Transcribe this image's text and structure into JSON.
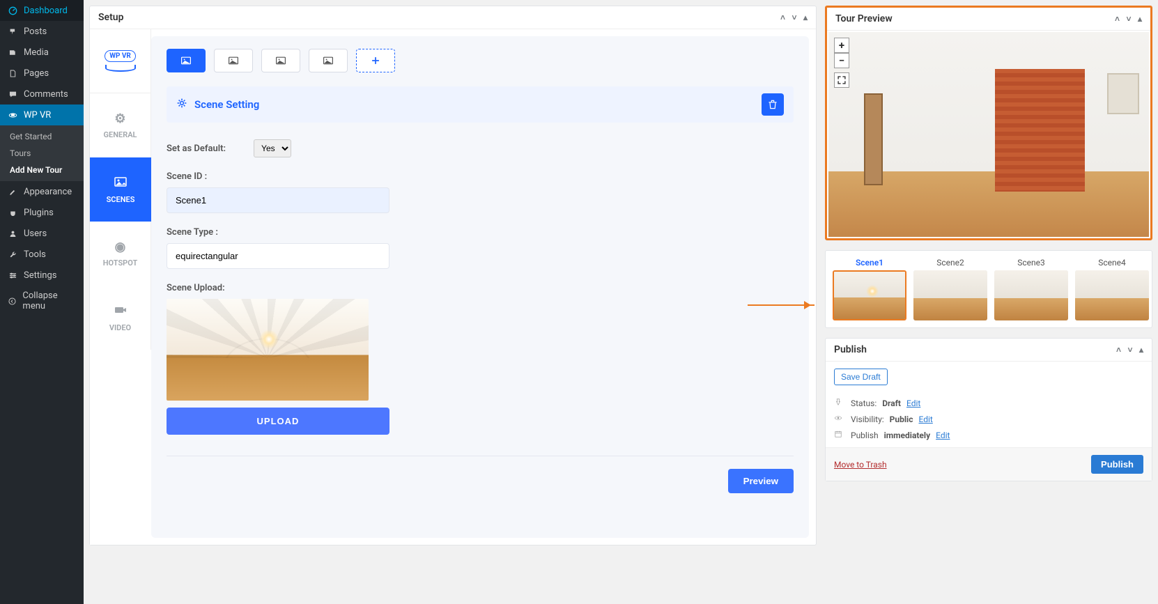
{
  "sidebar": {
    "items": [
      {
        "label": "Dashboard",
        "icon": "dashboard"
      },
      {
        "label": "Posts",
        "icon": "pin"
      },
      {
        "label": "Media",
        "icon": "media"
      },
      {
        "label": "Pages",
        "icon": "page"
      },
      {
        "label": "Comments",
        "icon": "comment"
      },
      {
        "label": "WP VR",
        "icon": "vr",
        "active": true
      },
      {
        "label": "Appearance",
        "icon": "brush"
      },
      {
        "label": "Plugins",
        "icon": "plugin"
      },
      {
        "label": "Users",
        "icon": "user"
      },
      {
        "label": "Tools",
        "icon": "wrench"
      },
      {
        "label": "Settings",
        "icon": "settings"
      },
      {
        "label": "Collapse menu",
        "icon": "collapse"
      }
    ],
    "wpvr_subs": [
      {
        "label": "Get Started"
      },
      {
        "label": "Tours"
      },
      {
        "label": "Add New Tour",
        "bold": true
      }
    ]
  },
  "setup": {
    "title": "Setup",
    "logo_text": "WP VR",
    "side_tabs": [
      {
        "label": "GENERAL",
        "icon": "gear"
      },
      {
        "label": "SCENES",
        "icon": "image",
        "active": true
      },
      {
        "label": "HOTSPOT",
        "icon": "target"
      },
      {
        "label": "VIDEO",
        "icon": "video"
      }
    ],
    "scene_setting_title": "Scene Setting",
    "default_label": "Set as Default:",
    "default_value": "Yes",
    "scene_id_label": "Scene ID :",
    "scene_id_value": "Scene1",
    "scene_type_label": "Scene Type :",
    "scene_type_value": "equirectangular",
    "scene_upload_label": "Scene Upload:",
    "upload_btn": "UPLOAD",
    "preview_btn": "Preview"
  },
  "tour": {
    "title": "Tour Preview",
    "zoom_in": "+",
    "zoom_out": "−",
    "scenes": [
      {
        "label": "Scene1",
        "active": true
      },
      {
        "label": "Scene2"
      },
      {
        "label": "Scene3"
      },
      {
        "label": "Scene4"
      }
    ]
  },
  "publish": {
    "title": "Publish",
    "save_draft": "Save Draft",
    "status_label": "Status:",
    "status_value": "Draft",
    "visibility_label": "Visibility:",
    "visibility_value": "Public",
    "schedule_label": "Publish",
    "schedule_value": "immediately",
    "edit": "Edit",
    "trash": "Move to Trash",
    "publish_btn": "Publish"
  }
}
